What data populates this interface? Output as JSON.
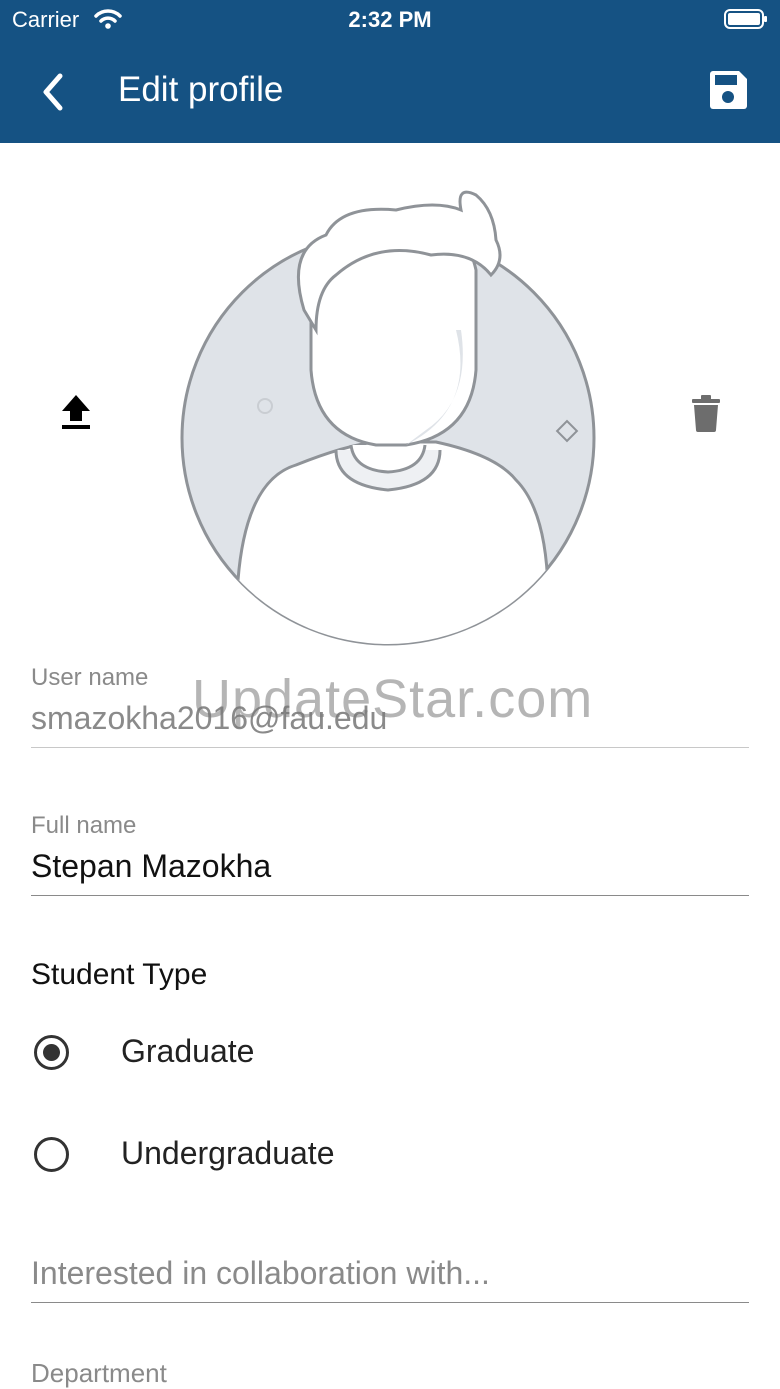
{
  "status_bar": {
    "carrier": "Carrier",
    "time": "2:32 PM"
  },
  "header": {
    "title": "Edit profile"
  },
  "watermark": "UpdateStar.com",
  "fields": {
    "username": {
      "label": "User name",
      "value": "smazokha2016@fau.edu"
    },
    "fullname": {
      "label": "Full name",
      "value": "Stepan Mazokha"
    },
    "collaboration": {
      "placeholder": "Interested in collaboration with..."
    },
    "department": {
      "label": "Department"
    }
  },
  "student_type": {
    "title": "Student Type",
    "options": [
      {
        "label": "Graduate",
        "selected": true
      },
      {
        "label": "Undergraduate",
        "selected": false
      }
    ]
  },
  "colors": {
    "header_bg": "#155283",
    "label_gray": "#8a8a8a"
  },
  "icons": [
    "wifi-icon",
    "battery-icon",
    "back-arrow-icon",
    "save-icon",
    "upload-icon",
    "trash-icon",
    "avatar-placeholder"
  ]
}
